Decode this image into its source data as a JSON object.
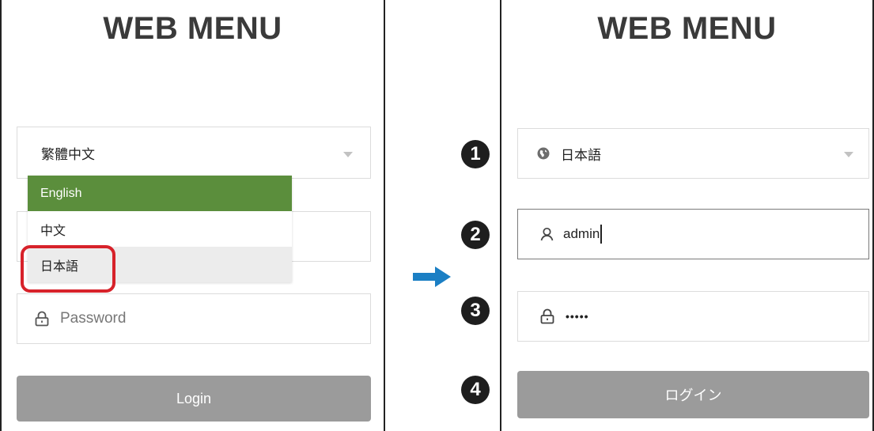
{
  "left_panel": {
    "title": "WEB MENU",
    "language_select": {
      "value": "繁體中文"
    },
    "dropdown_options": [
      {
        "label": "English",
        "state": "selected"
      },
      {
        "label": "中文",
        "state": "normal"
      },
      {
        "label": "日本語",
        "state": "hover"
      }
    ],
    "password": {
      "placeholder": "Password"
    },
    "login_label": "Login"
  },
  "right_panel": {
    "title": "WEB MENU",
    "language_select": {
      "value": "日本語"
    },
    "username": {
      "value": "admin"
    },
    "password": {
      "value": "•••••"
    },
    "login_label": "ログイン"
  },
  "steps": [
    "1",
    "2",
    "3",
    "4"
  ],
  "icons": {
    "globe": "globe-icon",
    "user": "user-icon",
    "lock": "lock-icon",
    "chevron": "chevron-down-icon",
    "arrow": "arrow-right-icon"
  },
  "colors": {
    "selected_option": "#5b8e3c",
    "hover_option": "#ececec",
    "highlight": "#d7222a",
    "arrow": "#1b7fc4",
    "button": "#9b9b9b",
    "step_badge": "#1e1e1e"
  }
}
